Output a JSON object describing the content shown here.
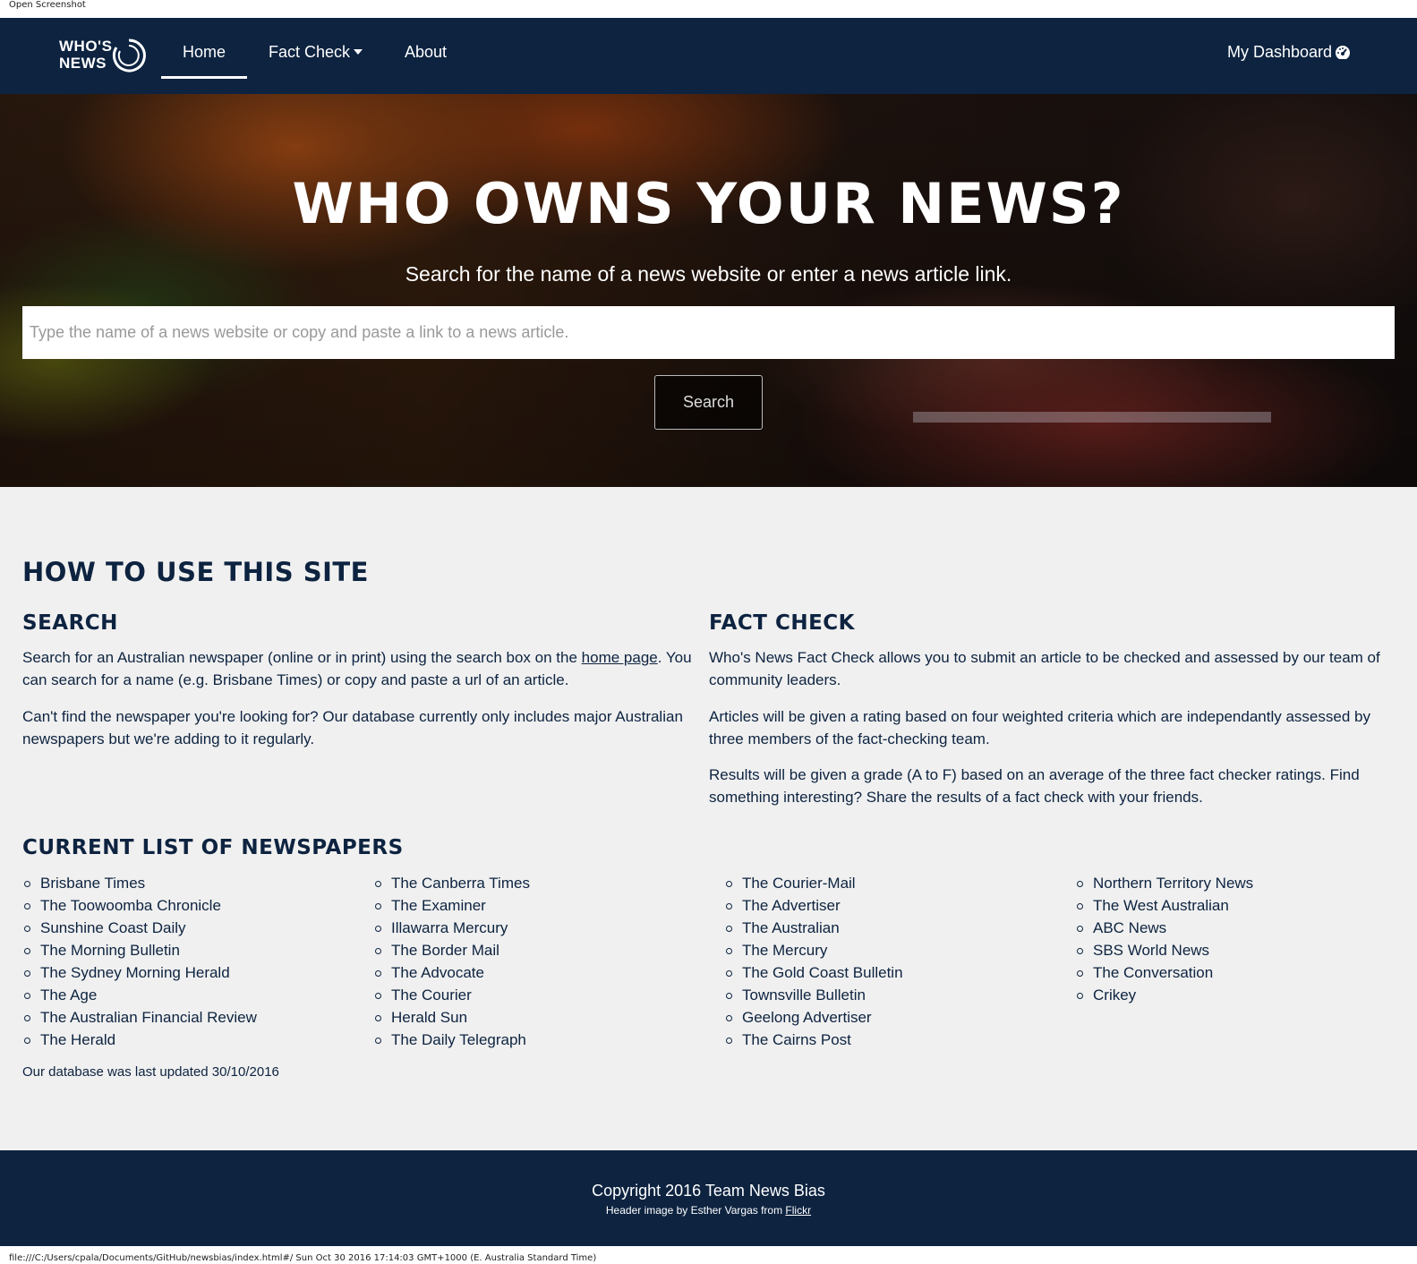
{
  "print": {
    "header": "Open Screenshot",
    "footer": "file:///C:/Users/cpala/Documents/GitHub/newsbias/index.html#/ Sun Oct 30 2016 17:14:03 GMT+1000 (E. Australia Standard Time)"
  },
  "nav": {
    "logo_line1": "WHO'S",
    "logo_line2": "NEWS",
    "home": "Home",
    "fact_check": "Fact Check",
    "about": "About",
    "dashboard": "My Dashboard",
    "active": "Home"
  },
  "hero": {
    "title": "WHO OWNS YOUR NEWS?",
    "subtitle": "Search for the name of a news website or enter a news article link.",
    "search_placeholder": "Type the name of a news website or copy and paste a link to a news article.",
    "search_value": "",
    "search_button": "Search"
  },
  "howto": {
    "heading": "HOW TO USE THIS SITE",
    "search_heading": "SEARCH",
    "search_p1_before": "Search for an Australian newspaper (online or in print) using the search box on the ",
    "search_p1_link": "home page",
    "search_p1_after": ". You can search for a name (e.g. Brisbane Times) or copy and paste a url of an article.",
    "search_p2": "Can't find the newspaper you're looking for? Our database currently only includes major Australian newspapers but we're adding to it regularly.",
    "fact_heading": "FACT CHECK",
    "fact_p1": "Who's News Fact Check allows you to submit an article to be checked and assessed by our team of community leaders.",
    "fact_p2": "Articles will be given a rating based on four weighted criteria which are independantly assessed by three members of the fact-checking team.",
    "fact_p3": "Results will be given a grade (A to F) based on an average of the three fact checker ratings. Find something interesting? Share the results of a fact check with your friends."
  },
  "newspapers": {
    "heading": "CURRENT LIST OF NEWSPAPERS",
    "col1": [
      "Brisbane Times",
      "The Toowoomba Chronicle",
      "Sunshine Coast Daily",
      "The Morning Bulletin",
      "The Sydney Morning Herald",
      "The Age",
      "The Australian Financial Review",
      "The Herald"
    ],
    "col2": [
      "The Canberra Times",
      "The Examiner",
      "Illawarra Mercury",
      "The Border Mail",
      "The Advocate",
      "The Courier",
      "Herald Sun",
      "The Daily Telegraph"
    ],
    "col3": [
      "The Courier-Mail",
      "The Advertiser",
      "The Australian",
      "The Mercury",
      "The Gold Coast Bulletin",
      "Townsville Bulletin",
      "Geelong Advertiser",
      "The Cairns Post"
    ],
    "col4": [
      "Northern Territory News",
      "The West Australian",
      "ABC News",
      "SBS World News",
      "The Conversation",
      "Crikey"
    ],
    "updated": "Our database was last updated 30/10/2016"
  },
  "footer": {
    "copyright": "Copyright 2016 Team News Bias",
    "credit_text": "Header image by Esther Vargas from ",
    "credit_link": "Flickr"
  },
  "colors": {
    "navy": "#0d2340",
    "content_bg": "#f0f0f0",
    "white": "#ffffff"
  }
}
